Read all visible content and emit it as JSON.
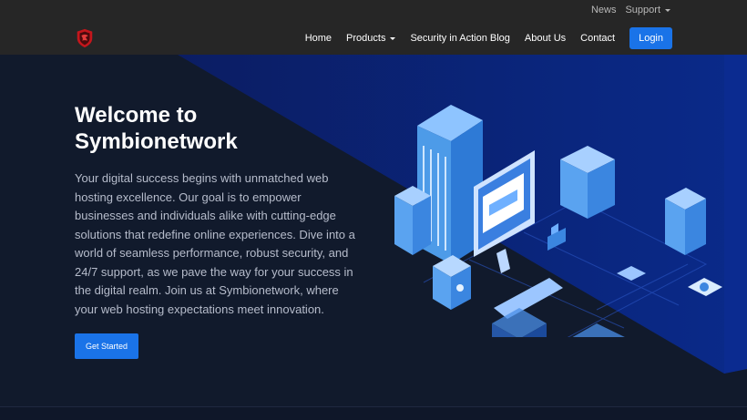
{
  "topbar": {
    "links": [
      "News",
      "Support"
    ]
  },
  "navbar": {
    "items": [
      {
        "label": "Home"
      },
      {
        "label": "Products"
      },
      {
        "label": "Security in Action Blog"
      },
      {
        "label": "About Us"
      },
      {
        "label": "Contact"
      }
    ],
    "login_label": "Login"
  },
  "hero": {
    "title_line1": "Welcome to",
    "title_line2": "Symbionetwork",
    "description": "Your digital success begins with unmatched web hosting excellence. Our goal is to empower businesses and individuals alike with cutting-edge solutions that redefine online experiences. Dive into a world of seamless performance, robust security, and 24/7 support, as we pave the way for your success in the digital realm. Join us at Symbionetwork, where your web hosting expectations meet innovation.",
    "cta_label": "Get Started"
  },
  "colors": {
    "accent": "#1a73e8",
    "nav_bg": "#262626",
    "hero_bg": "#111a2c",
    "hero_panel": "#0a1f66"
  }
}
